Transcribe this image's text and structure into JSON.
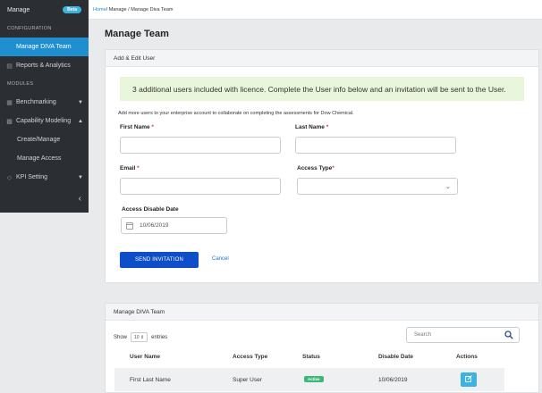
{
  "sidebar": {
    "title": "Manage",
    "beta": "Beta",
    "section_config": "CONFIGURATION",
    "section_modules": "MODULES",
    "items": [
      {
        "label": "Manage DIVA Team"
      },
      {
        "label": "Reports & Analytics"
      },
      {
        "label": "Benchmarking"
      },
      {
        "label": "Capability Modeling"
      },
      {
        "label": "Create/Manage"
      },
      {
        "label": "Manage Access"
      },
      {
        "label": "KPI Setting"
      }
    ],
    "collapse": "‹"
  },
  "breadcrumb": {
    "home": "Home",
    "rest": " / Manage / Manage Diva Team"
  },
  "page_title": "Manage Team",
  "form_panel": {
    "title": "Add & Edit User",
    "notice": "3 additional users included with licence. Complete the User info below and an invitation will be sent to the User.",
    "helptext": "Add more users to your enterprise account to collaborate on completing the assessments for Dow Chemical.",
    "first_name_label": "First Name",
    "last_name_label": "Last Name",
    "email_label": "Email",
    "access_type_label": "Access Type",
    "access_disable_label": "Access Disable Date",
    "access_disable_value": "10/06/2019",
    "required_mark": "*",
    "send_button": "SEND INVITATION",
    "cancel_link": "Cancel"
  },
  "team_panel": {
    "title": "Manage DIVA Team",
    "show_label": "Show",
    "entries_value": "10",
    "entries_label": "entries",
    "search_placeholder": "Search",
    "columns": [
      "User Name",
      "Access Type",
      "Status",
      "Disable Date",
      "Actions"
    ],
    "rows": [
      {
        "user_name": "First Last Name",
        "access_type": "Super User",
        "status": "Active",
        "disable_date": "10/06/2019"
      }
    ]
  },
  "colors": {
    "accent": "#1f8fd0",
    "primary_button": "#0f4ec9",
    "notice_bg": "#eaf6dc",
    "active_badge": "#3cb878"
  }
}
